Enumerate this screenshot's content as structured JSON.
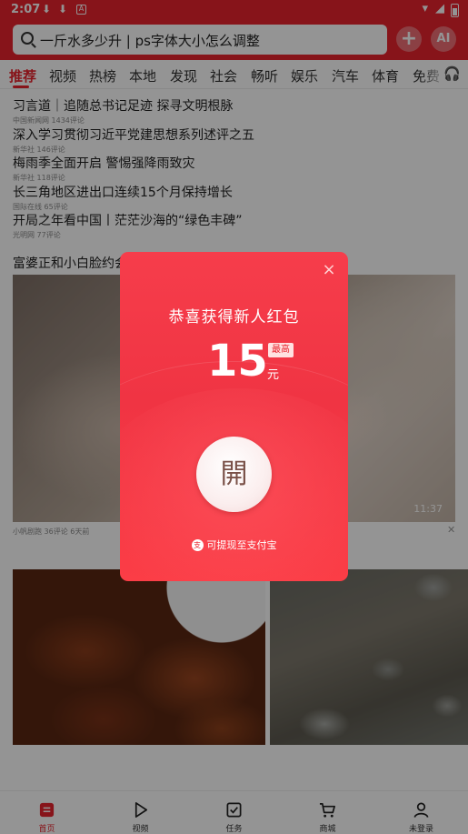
{
  "status_bar": {
    "time": "2:07",
    "a_icon": "A"
  },
  "search": {
    "placeholder": "一斤水多少升 | ps字体大小怎么调整"
  },
  "header": {
    "add_label": "+",
    "ai_label": "AI"
  },
  "tabs": [
    "推荐",
    "视频",
    "热榜",
    "本地",
    "发现",
    "社会",
    "畅听",
    "娱乐",
    "汽车",
    "体育",
    "免费"
  ],
  "news": [
    {
      "title": "习言道｜追随总书记足迹 探寻文明根脉",
      "meta": "中国新闻网 1434评论"
    },
    {
      "title": "深入学习贯彻习近平党建思想系列述评之五",
      "meta": "新华社 146评论"
    },
    {
      "title": "梅雨季全面开启 警惕强降雨致灾",
      "meta": "新华社 118评论"
    },
    {
      "title": "长三角地区进出口连续15个月保持增长",
      "meta": "国际在线 65评论"
    },
    {
      "title": "开局之年看中国丨茫茫沙海的“绿色丰碑”",
      "meta": "光明网 77评论"
    }
  ],
  "video": {
    "title": "富婆正和小白脸约会",
    "duration": "11:37",
    "meta": "小帆剧跑 36评论 6天前",
    "close": "✕"
  },
  "bottom_nav": [
    {
      "label": "首页",
      "icon": "home-icon"
    },
    {
      "label": "视频",
      "icon": "play-icon"
    },
    {
      "label": "任务",
      "icon": "task-icon"
    },
    {
      "label": "商城",
      "icon": "cart-icon"
    },
    {
      "label": "未登录",
      "icon": "user-icon"
    }
  ],
  "red_packet": {
    "title": "恭喜获得新人红包",
    "amount": "15",
    "badge": "最高",
    "unit": "元",
    "open_label": "開",
    "alipay_icon": "支",
    "alipay_text": "可提现至支付宝",
    "close": "×"
  },
  "colors": {
    "brand_red": "#e8232d",
    "packet_red": "#f03443"
  }
}
